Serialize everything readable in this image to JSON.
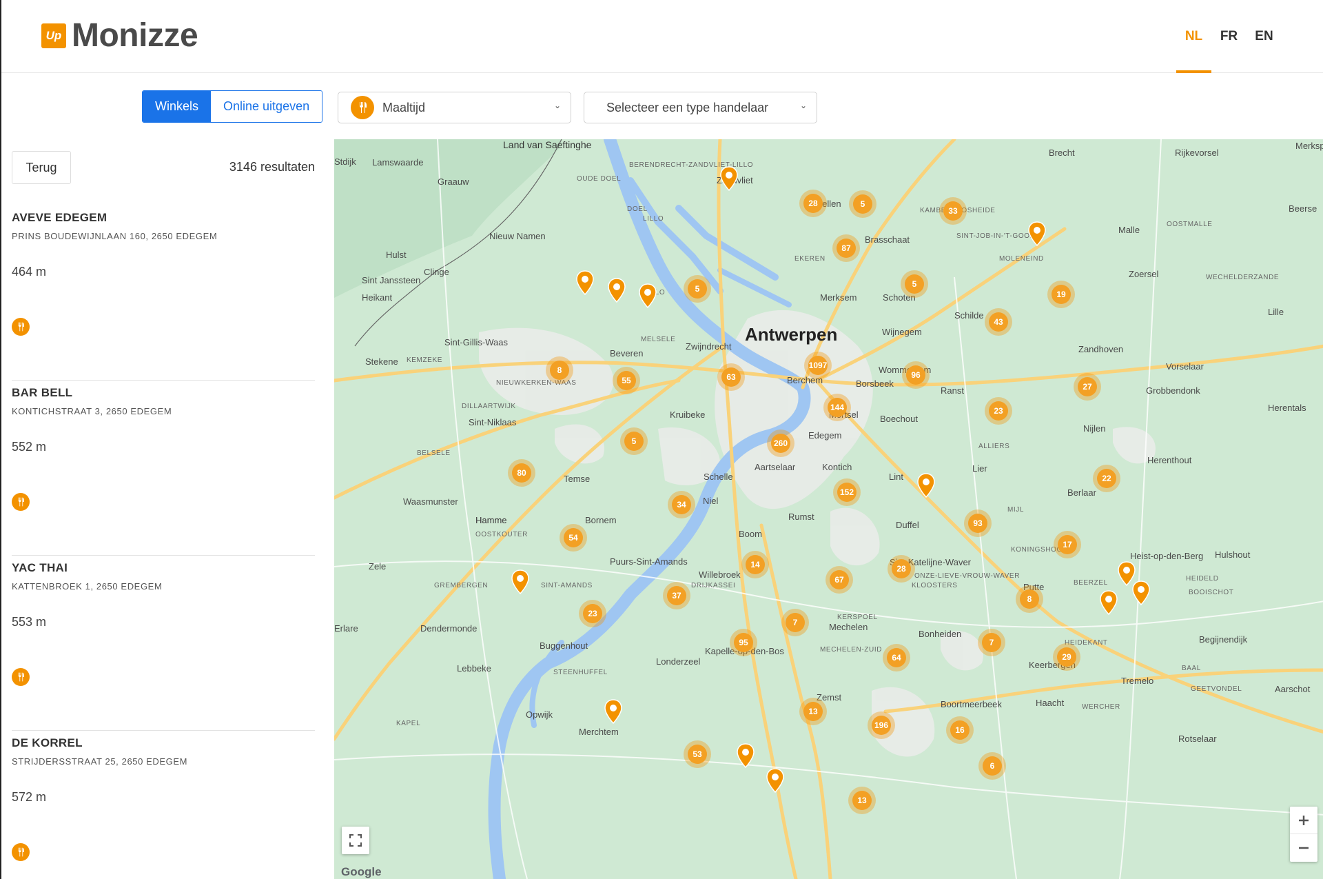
{
  "header": {
    "logo_badge": "Up",
    "logo_text": "Monizze",
    "languages": [
      {
        "code": "NL",
        "active": true
      },
      {
        "code": "FR",
        "active": false
      },
      {
        "code": "EN",
        "active": false
      }
    ]
  },
  "filters": {
    "segments": [
      {
        "label": "Winkels",
        "active": true
      },
      {
        "label": "Online uitgeven",
        "active": false
      }
    ],
    "category_select": {
      "value": "Maaltijd",
      "icon": "cutlery-icon"
    },
    "merchant_type_select": {
      "value": "Selecteer een type handelaar"
    }
  },
  "sidebar": {
    "back_label": "Terug",
    "results_label": "3146 resultaten",
    "items": [
      {
        "name": "AVEVE EDEGEM",
        "address": "PRINS BOUDEWIJNLAAN 160, 2650 EDEGEM",
        "distance": "464 m",
        "icon": "cutlery-icon"
      },
      {
        "name": "BAR BELL",
        "address": "KONTICHSTRAAT 3, 2650 EDEGEM",
        "distance": "552 m",
        "icon": "cutlery-icon"
      },
      {
        "name": "YAC THAI",
        "address": "KATTENBROEK 1, 2650 EDEGEM",
        "distance": "553 m",
        "icon": "cutlery-icon"
      },
      {
        "name": "DE KORREL",
        "address": "STRIJDERSSTRAAT 25, 2650 EDEGEM",
        "distance": "572 m",
        "icon": "cutlery-icon"
      }
    ]
  },
  "map": {
    "colors": {
      "land": "#cfe9d3",
      "water": "#9fc6f2",
      "road": "#f9d27a",
      "urban": "#e8ece8",
      "accent": "#f39200"
    },
    "clusters": [
      "28",
      "5",
      "33",
      "87",
      "5",
      "5",
      "43",
      "19",
      "1097",
      "63",
      "96",
      "8",
      "55",
      "144",
      "27",
      "23",
      "5",
      "260",
      "80",
      "22",
      "152",
      "34",
      "93",
      "54",
      "17",
      "14",
      "28",
      "67",
      "37",
      "23",
      "8",
      "7",
      "7",
      "95",
      "64",
      "29",
      "13",
      "196",
      "16",
      "53",
      "6",
      "13"
    ],
    "places": [
      "Antwerpen",
      "Brecht",
      "Rijkevorsel",
      "Merksplas",
      "Beerse",
      "Lamswaarde",
      "Land van Saeftinghe",
      "Stdijk",
      "Graauw",
      "Kapellen",
      "Brasschaat",
      "Kambeenbosheide",
      "Sint-Job-in-'t-Goor",
      "Malle",
      "Oostmalle",
      "Doel",
      "Lillo",
      "Nieuw Namen",
      "Hulst",
      "Clinge",
      "Sint Janssteen",
      "Heikant",
      "Ekeren",
      "Merksem",
      "Schoten",
      "Schilde",
      "Moleneind",
      "Zoersel",
      "Wechelderzande",
      "Lille",
      "Kallo",
      "Sint-Gillis-Waas",
      "Melsele",
      "Beveren",
      "Zwijndrecht",
      "Wijnegem",
      "Zandhoven",
      "Stekene",
      "Kemzeke",
      "Berchem",
      "Wommelgem",
      "Borsbeek",
      "Ranst",
      "Vorselaar",
      "Grobbendonk",
      "Herentals",
      "Nieuwkerken-Waas",
      "Dillaartwijk",
      "Sint-Niklaas",
      "Kruibeke",
      "Mortsel",
      "Edegem",
      "Boechout",
      "Nijlen",
      "Belsele",
      "Temse",
      "Kontich",
      "Lier",
      "Herenthout",
      "Aartselaar",
      "Schelle",
      "Waasmunster",
      "Hamme",
      "Niel",
      "Rumst",
      "Duffel",
      "Lint",
      "Berlaar",
      "Bornem",
      "Oostkouter",
      "Boom",
      "Puurs-Sint-Amands",
      "Willebroek",
      "Sint-Katelijne-Waver",
      "Koningshooikt",
      "Heist-op-den-Berg",
      "Hulshout",
      "Zele",
      "Grembergen",
      "Sint-Amands",
      "Drijkassei",
      "Onze-Lieve-Vrouw-Waver",
      "Kloosters",
      "Putte",
      "Beerzel",
      "Heideld",
      "Booischot",
      "Dendermonde",
      "Buggenhout",
      "Mechelen",
      "Kerspoel",
      "Bonheiden",
      "Begijnendijk",
      "Lebbeke",
      "Londerzeel",
      "Kapelle-op-den-Bos",
      "Heidekant",
      "Keerbergen",
      "Steenhuffel",
      "Mechelen-Zuid",
      "Tremelo",
      "Baal",
      "Zemst",
      "Haacht",
      "Boortmeerbeek",
      "Opwijk",
      "Kapel",
      "Merchtem",
      "Rotselaar",
      "Geetvondel",
      "Wercher",
      "Aarschot",
      "Oude Doel",
      "Berendrecht-Zandvliet-Lillo",
      "Zandvliet",
      "Alliers",
      "Mijl",
      "Erlare",
      "Hamme"
    ],
    "google_label": "Google",
    "fullscreen_icon": "fullscreen-icon",
    "zoom_in_icon": "zoom-in-icon",
    "zoom_out_icon": "zoom-out-icon"
  }
}
